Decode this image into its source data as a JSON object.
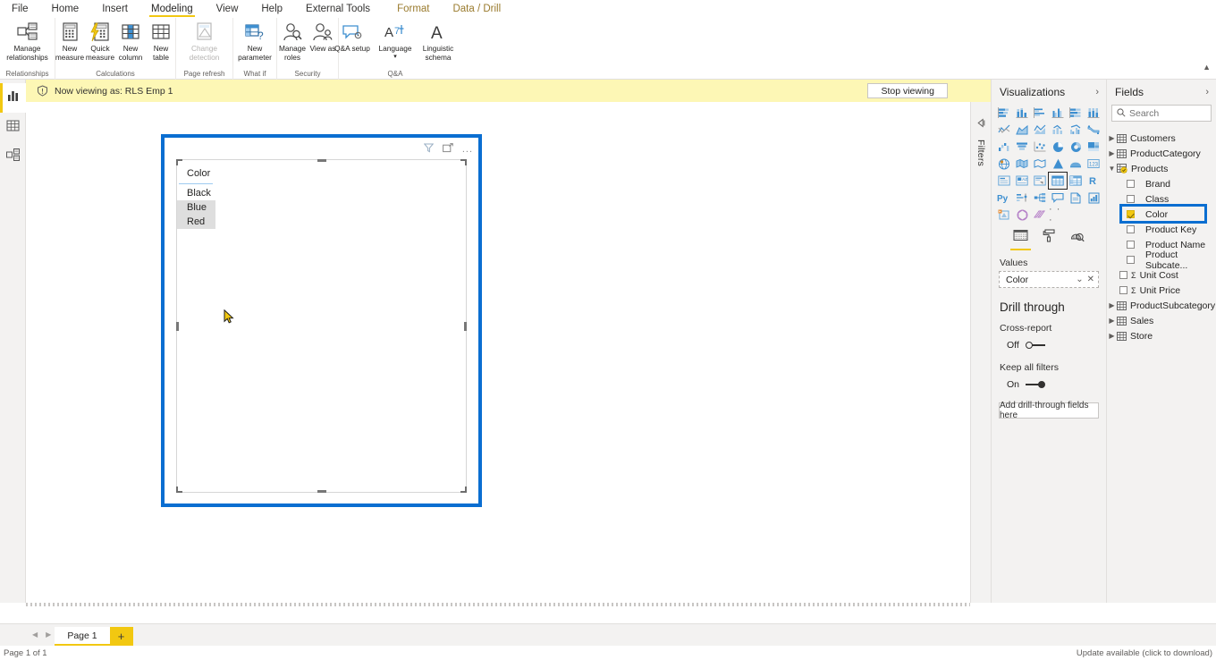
{
  "ribbon": {
    "tabs": [
      {
        "label": "File",
        "active": false,
        "contextual": false
      },
      {
        "label": "Home",
        "active": false,
        "contextual": false
      },
      {
        "label": "Insert",
        "active": false,
        "contextual": false
      },
      {
        "label": "Modeling",
        "active": true,
        "contextual": false
      },
      {
        "label": "View",
        "active": false,
        "contextual": false
      },
      {
        "label": "Help",
        "active": false,
        "contextual": false
      },
      {
        "label": "External Tools",
        "active": false,
        "contextual": false
      },
      {
        "label": "Format",
        "active": false,
        "contextual": true
      },
      {
        "label": "Data / Drill",
        "active": false,
        "contextual": true
      }
    ],
    "collapse_icon": "chevron-up-icon",
    "groups": [
      {
        "name": "Relationships",
        "buttons": [
          {
            "label": "Manage relationships",
            "icon": "manage-relationships-icon",
            "disabled": false
          }
        ]
      },
      {
        "name": "Calculations",
        "buttons": [
          {
            "label": "New measure",
            "icon": "new-measure-icon",
            "disabled": false
          },
          {
            "label": "Quick measure",
            "icon": "quick-measure-icon",
            "disabled": false
          },
          {
            "label": "New column",
            "icon": "new-column-icon",
            "disabled": false
          },
          {
            "label": "New table",
            "icon": "new-table-icon",
            "disabled": false
          }
        ]
      },
      {
        "name": "Page refresh",
        "buttons": [
          {
            "label": "Change detection",
            "icon": "change-detection-icon",
            "disabled": true
          }
        ]
      },
      {
        "name": "What if",
        "buttons": [
          {
            "label": "New parameter",
            "icon": "new-parameter-icon",
            "disabled": false
          }
        ]
      },
      {
        "name": "Security",
        "buttons": [
          {
            "label": "Manage roles",
            "icon": "manage-roles-icon",
            "disabled": false
          },
          {
            "label": "View as",
            "icon": "view-as-icon",
            "disabled": false
          }
        ]
      },
      {
        "name": "Q&A",
        "buttons": [
          {
            "label": "Q&A setup",
            "icon": "qa-setup-icon",
            "disabled": false
          },
          {
            "label": "Language",
            "icon": "language-icon",
            "disabled": false
          },
          {
            "label": "Linguistic schema",
            "icon": "linguistic-schema-icon",
            "disabled": false
          }
        ]
      }
    ]
  },
  "view_rail": {
    "items": [
      {
        "name": "report-view",
        "icon": "report-chart-icon",
        "active": true
      },
      {
        "name": "data-view",
        "icon": "data-table-icon",
        "active": false
      },
      {
        "name": "model-view",
        "icon": "model-relationships-icon",
        "active": false
      }
    ]
  },
  "rls_banner": {
    "icon": "warning-shield-icon",
    "message": "Now viewing as: RLS Emp 1",
    "stop_button": "Stop viewing",
    "background": "#fdf7b5"
  },
  "canvas": {
    "visual": {
      "selected": true,
      "selection_color": "#0a6ed1",
      "header_icons": [
        {
          "name": "filter-icon",
          "glyph": "filter"
        },
        {
          "name": "focus-mode-icon",
          "glyph": "focus"
        },
        {
          "name": "more-options-icon",
          "glyph": "..."
        }
      ],
      "table": {
        "column_header": "Color",
        "rows": [
          "Black",
          "Blue",
          "Red"
        ],
        "shaded_rows": [
          false,
          true,
          true
        ]
      },
      "cursor": "arrow-cursor"
    }
  },
  "filters_rail": {
    "expand_icon": "expand-left-icon",
    "label": "Filters"
  },
  "visualizations": {
    "title": "Visualizations",
    "chevron": "chevron-right-icon",
    "icons": [
      "stacked-bar-chart",
      "stacked-column-chart",
      "clustered-bar-chart",
      "clustered-column-chart",
      "100-stacked-bar-chart",
      "100-stacked-column-chart",
      "line-chart",
      "area-chart",
      "stacked-area-chart",
      "line-stacked-column-chart",
      "line-clustered-column-chart",
      "ribbon-chart",
      "waterfall-chart",
      "funnel-chart",
      "scatter-chart",
      "pie-chart",
      "donut-chart",
      "treemap",
      "map",
      "filled-map",
      "shape-map",
      "azure-map",
      "arcgis-map",
      "r-script-visual-alt",
      "card",
      "multi-row-card",
      "kpi",
      "slicer",
      "table",
      "matrix",
      "r-script-visual",
      "python-visual",
      "key-influencers",
      "decomposition-tree",
      "qa-visual",
      "paginated-report",
      "power-apps",
      "power-automate",
      "narrative",
      "smart-narrative"
    ],
    "selected_icon": "table",
    "more_glyph": "· · ·",
    "format_tabs": [
      {
        "name": "fields-tab",
        "icon": "fields-pane-icon",
        "active": true
      },
      {
        "name": "format-tab",
        "icon": "paint-roller-icon",
        "active": false
      },
      {
        "name": "analytics-tab",
        "icon": "analytics-magnifier-icon",
        "active": false
      }
    ],
    "wells": [
      {
        "label": "Values",
        "field": "Color",
        "dropdown_icon": "chevron-down-icon",
        "remove_icon": "close-icon"
      }
    ],
    "drill_through": {
      "title": "Drill through",
      "cross_report": {
        "label": "Cross-report",
        "state": "Off",
        "on": false
      },
      "keep_all_filters": {
        "label": "Keep all filters",
        "state": "On",
        "on": true
      },
      "drop_zone": "Add drill-through fields here"
    }
  },
  "fields": {
    "title": "Fields",
    "chevron": "chevron-right-icon",
    "search_placeholder": "Search",
    "search_value": "",
    "search_icon": "search-icon",
    "tables": [
      {
        "name": "Customers",
        "expanded": false,
        "icon": "table-icon",
        "children": []
      },
      {
        "name": "ProductCategory",
        "expanded": false,
        "icon": "table-icon",
        "children": []
      },
      {
        "name": "Products",
        "expanded": true,
        "icon": "table-rls-icon",
        "children": [
          {
            "name": "Brand",
            "checked": false,
            "measure": false,
            "highlighted": false
          },
          {
            "name": "Class",
            "checked": false,
            "measure": false,
            "highlighted": false
          },
          {
            "name": "Color",
            "checked": true,
            "measure": false,
            "highlighted": true
          },
          {
            "name": "Product Key",
            "checked": false,
            "measure": false,
            "highlighted": false
          },
          {
            "name": "Product Name",
            "checked": false,
            "measure": false,
            "highlighted": false
          },
          {
            "name": "Product Subcate...",
            "checked": false,
            "measure": false,
            "highlighted": false
          },
          {
            "name": "Unit Cost",
            "checked": false,
            "measure": true,
            "highlighted": false
          },
          {
            "name": "Unit Price",
            "checked": false,
            "measure": true,
            "highlighted": false
          }
        ]
      },
      {
        "name": "ProductSubcategory",
        "expanded": false,
        "icon": "table-icon",
        "children": []
      },
      {
        "name": "Sales",
        "expanded": false,
        "icon": "table-icon",
        "children": []
      },
      {
        "name": "Store",
        "expanded": false,
        "icon": "table-icon",
        "children": []
      }
    ]
  },
  "page_bar": {
    "prev_icon": "chevron-left-icon",
    "next_icon": "chevron-right-icon",
    "tabs": [
      {
        "label": "Page 1",
        "active": true
      }
    ],
    "add_page_glyph": "+"
  },
  "status_bar": {
    "left": "Page 1 of 1",
    "right": "Update available (click to download)"
  }
}
